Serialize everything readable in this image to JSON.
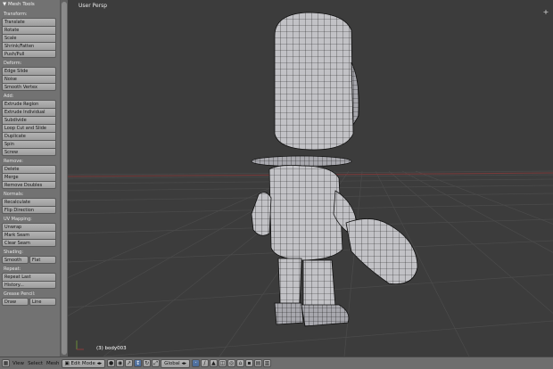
{
  "toolshelf": {
    "title": "▼ Mesh Tools",
    "transform": {
      "title": "Transform:",
      "buttons": [
        "Translate",
        "Rotate",
        "Scale",
        "Shrink/Fatten",
        "Push/Pull"
      ]
    },
    "deform": {
      "title": "Deform:",
      "buttons": [
        "Edge Slide",
        "Noise",
        "Smooth Vertex"
      ]
    },
    "add": {
      "title": "Add:",
      "buttons": [
        "Extrude Region",
        "Extrude Individual",
        "Subdivide",
        "Loop Cut and Slide",
        "Duplicate",
        "Spin",
        "Screw"
      ]
    },
    "remove": {
      "title": "Remove:",
      "buttons": [
        "Delete",
        "Merge",
        "Remove Doubles"
      ]
    },
    "normals": {
      "title": "Normals:",
      "buttons": [
        "Recalculate",
        "Flip Direction"
      ]
    },
    "uv": {
      "title": "UV Mapping:",
      "buttons": [
        "Unwrap",
        "Mark Seam",
        "Clear Seam"
      ]
    },
    "shading": {
      "title": "Shading:",
      "smooth": "Smooth",
      "flat": "Flat"
    },
    "repeat": {
      "title": "Repeat:",
      "buttons": [
        "Repeat Last",
        "History..."
      ]
    },
    "grease": {
      "title": "Grease Pencil:",
      "draw": "Draw",
      "line": "Line"
    }
  },
  "viewport": {
    "view_label": "User Persp",
    "object_label": "(3) body003",
    "background": "#3c3c3c",
    "grid_color": "#4a4a4a",
    "x_axis_color": "#8a3a3a"
  },
  "header": {
    "menu_view": "View",
    "menu_select": "Select",
    "menu_mesh": "Mesh",
    "mode": "Edit Mode",
    "orientation": "Global"
  },
  "colors": {
    "panel": "#727272",
    "button": "#a8a8a8",
    "active": "#5a7aa8",
    "mesh_fill": "#c4c4c8",
    "mesh_wire": "#1a1a1a"
  }
}
